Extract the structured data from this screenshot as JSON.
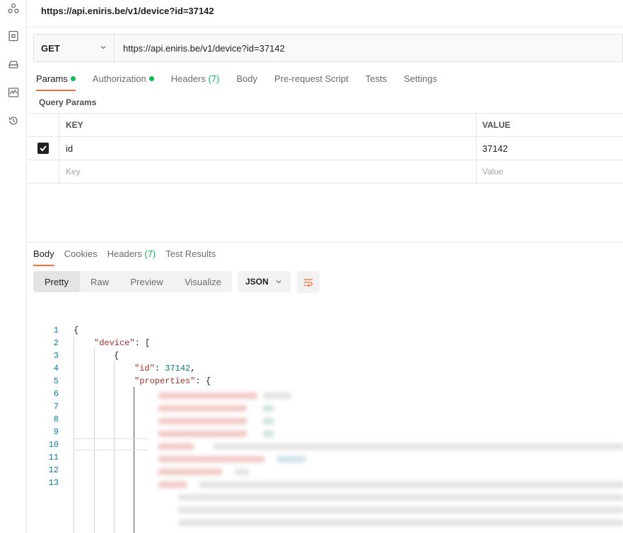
{
  "request": {
    "title": "https://api.eniris.be/v1/device?id=37142",
    "method": "GET",
    "url": "https://api.eniris.be/v1/device?id=37142"
  },
  "request_tabs": {
    "params": "Params",
    "authorization": "Authorization",
    "headers": "Headers",
    "headers_count": "(7)",
    "body": "Body",
    "pre_request": "Pre-request Script",
    "tests": "Tests",
    "settings": "Settings"
  },
  "query_params": {
    "section_label": "Query Params",
    "key_header": "KEY",
    "value_header": "VALUE",
    "rows": [
      {
        "key": "id",
        "value": "37142",
        "checked": true
      }
    ],
    "key_placeholder": "Key",
    "value_placeholder": "Value"
  },
  "response_tabs": {
    "body": "Body",
    "cookies": "Cookies",
    "headers": "Headers",
    "headers_count": "(7)",
    "test_results": "Test Results"
  },
  "view_modes": {
    "pretty": "Pretty",
    "raw": "Raw",
    "preview": "Preview",
    "visualize": "Visualize",
    "format": "JSON"
  },
  "code": {
    "line_numbers": [
      "1",
      "2",
      "3",
      "4",
      "5",
      "6",
      "7",
      "8",
      "9",
      "10",
      "11",
      "12",
      "13"
    ],
    "l1": "{",
    "l2_key": "\"device\"",
    "l2_rest": ": [",
    "l3": "{",
    "l4_key": "\"id\"",
    "l4_sep": ": ",
    "l4_val": "37142",
    "l4_end": ",",
    "l5_key": "\"properties\"",
    "l5_rest": ": {"
  },
  "colors": {
    "accent": "#ff6c37",
    "success": "#0cbb52",
    "json_key": "#a4302b",
    "json_number": "#0b7a6e",
    "line_number": "#0a7ea4"
  }
}
